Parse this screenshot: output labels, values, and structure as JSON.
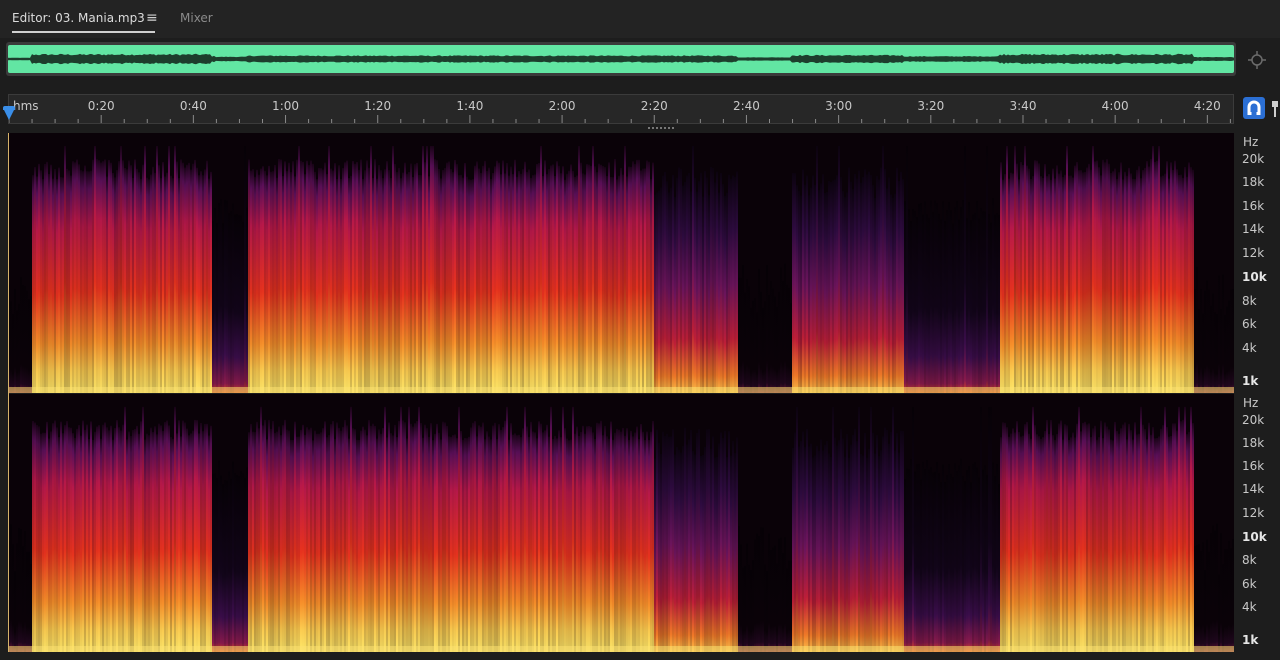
{
  "tabs": {
    "editor_label": "Editor: 03. Mania.mp3",
    "menu_icon": "hamburger-menu-icon",
    "mixer_label": "Mixer"
  },
  "overview": {
    "waveform_color": "#62e6a3",
    "zoom_icon": "zoom-navigator-icon"
  },
  "ruler": {
    "unit": "hms",
    "ticks": [
      "0:20",
      "0:40",
      "1:00",
      "1:20",
      "1:40",
      "2:00",
      "2:20",
      "2:40",
      "3:00",
      "3:20",
      "3:40",
      "4:00",
      "4:20"
    ],
    "tick_seconds": [
      20,
      40,
      60,
      80,
      100,
      120,
      140,
      160,
      180,
      200,
      220,
      240,
      260
    ],
    "duration_seconds": 266,
    "playhead_seconds": 0
  },
  "toolbar_icons": {
    "snap": "snap-magnet-icon",
    "marker": "marker-icon"
  },
  "frequency_scale": {
    "unit": "Hz",
    "labels": [
      "20k",
      "18k",
      "16k",
      "14k",
      "12k",
      "10k",
      "8k",
      "6k",
      "4k",
      "1k"
    ],
    "bold_labels": [
      "10k",
      "1k"
    ]
  },
  "spectrogram": {
    "channels": [
      "left",
      "right"
    ],
    "palette": [
      "#0a0208",
      "#3a0a4a",
      "#7a1460",
      "#c41e3a",
      "#f04a1a",
      "#fba02c",
      "#fde86a"
    ]
  }
}
